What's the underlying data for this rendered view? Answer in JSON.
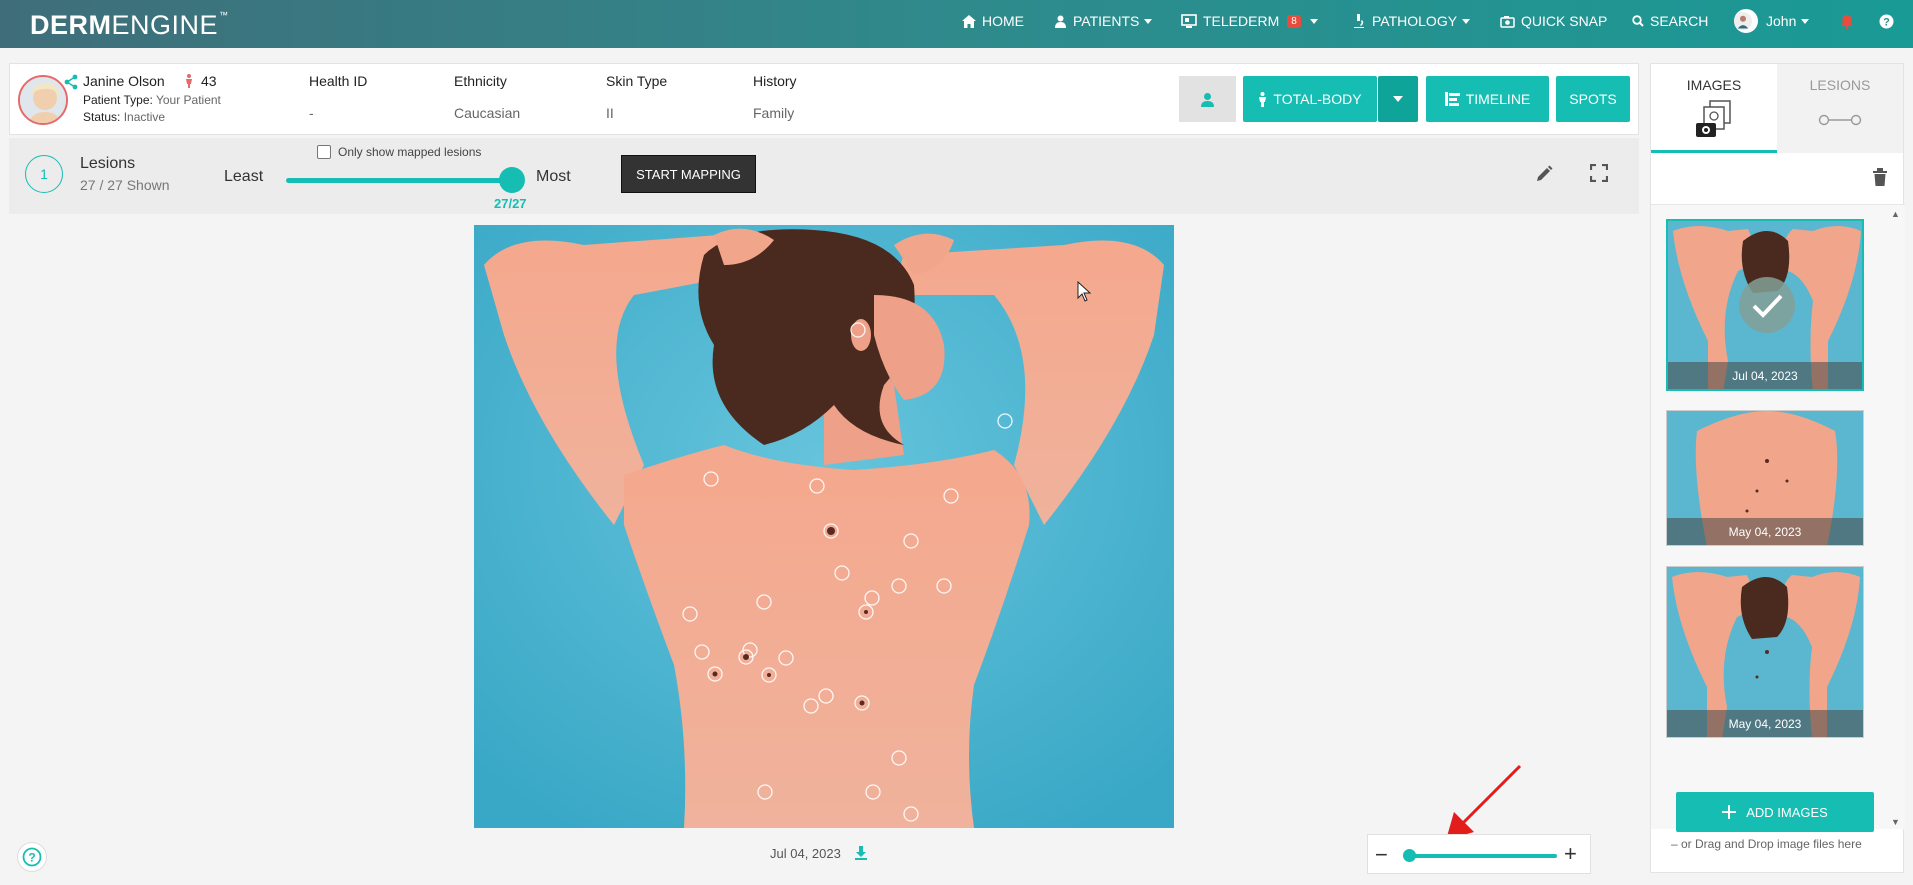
{
  "navbar": {
    "logo_bold": "DERM",
    "logo_light": "ENGINE",
    "logo_tm": "™",
    "items": {
      "home": "HOME",
      "patients": "PATIENTS",
      "telederm": "TELEDERM",
      "telederm_badge": "8",
      "pathology": "PATHOLOGY",
      "quick_snap": "QUICK SNAP",
      "search": "SEARCH",
      "user": "John"
    }
  },
  "patient": {
    "name": "Janine Olson",
    "age": "43",
    "type_label": "Patient Type:",
    "type_value": "Your Patient",
    "status_label": "Status:",
    "status_value": "Inactive",
    "fields": [
      {
        "header": "Health ID",
        "value": "-"
      },
      {
        "header": "Ethnicity",
        "value": "Caucasian"
      },
      {
        "header": "Skin Type",
        "value": "II"
      },
      {
        "header": "History",
        "value": "Family"
      }
    ]
  },
  "actions": {
    "total_body": "TOTAL-BODY",
    "timeline": "TIMELINE",
    "spots": "SPOTS"
  },
  "lesions_bar": {
    "number": "1",
    "title": "Lesions",
    "count": "27 / 27 Shown",
    "least": "Least",
    "most": "Most",
    "slider_value": "27/27",
    "checkbox_label": "Only show mapped lesions",
    "start_mapping": "START MAPPING"
  },
  "main_image": {
    "date": "Jul 04, 2023"
  },
  "right_panel": {
    "tab_images": "IMAGES",
    "tab_lesions": "LESIONS",
    "thumbnails": [
      {
        "date": "Jul 04, 2023"
      },
      {
        "date": "May 04, 2023"
      },
      {
        "date": "May 04, 2023"
      }
    ],
    "add_images": "ADD IMAGES",
    "drag_drop": "– or Drag and Drop image files here"
  },
  "colors": {
    "accent": "#16bdb2",
    "navbar": "#2f8a8c"
  }
}
